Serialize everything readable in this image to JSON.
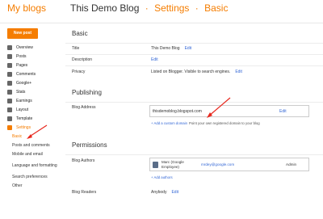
{
  "header": {
    "brand": "My blogs",
    "blog_name": "This Demo Blog",
    "separator": "·",
    "section": "Settings",
    "subsection": "Basic"
  },
  "new_post_label": "New post",
  "sidebar": {
    "items": [
      {
        "label": "Overview",
        "icon": "home-icon"
      },
      {
        "label": "Posts",
        "icon": "posts-icon"
      },
      {
        "label": "Pages",
        "icon": "pages-icon"
      },
      {
        "label": "Comments",
        "icon": "comments-icon"
      },
      {
        "label": "Google+",
        "icon": "google-plus-icon"
      },
      {
        "label": "Stats",
        "icon": "stats-icon"
      },
      {
        "label": "Earnings",
        "icon": "earnings-icon"
      },
      {
        "label": "Layout",
        "icon": "layout-icon"
      },
      {
        "label": "Template",
        "icon": "template-icon"
      },
      {
        "label": "Settings",
        "icon": "wrench-icon"
      }
    ],
    "settings_sub": [
      "Basic",
      "Posts and comments",
      "Mobile and email",
      "Language and formatting",
      "Search preferences",
      "Other"
    ]
  },
  "basic": {
    "title": "Basic",
    "title_label": "Title",
    "title_value": "This Demo Blog",
    "description_label": "Description",
    "privacy_label": "Privacy",
    "privacy_value": "Listed on Blogger. Visible to search engines.",
    "edit": "Edit"
  },
  "publishing": {
    "title": "Publishing",
    "blog_address_label": "Blog Address",
    "blog_address_value": "thisdemoblog.blogspot.com",
    "edit": "Edit",
    "add_domain_link": "+ Add a custom domain",
    "add_domain_hint": "Point your own registered domain to your blog"
  },
  "permissions": {
    "title": "Permissions",
    "authors_label": "Blog Authors",
    "author_name": "Marc (Google Employee)",
    "author_email": "mrdey@google.com",
    "author_role": "Admin",
    "add_authors": "+ Add authors",
    "readers_label": "Blog Readers",
    "readers_value": "Anybody",
    "edit": "Edit"
  },
  "colors": {
    "accent": "#f57d00",
    "link": "#3367d6",
    "annotation_arrow": "#e8281e"
  }
}
